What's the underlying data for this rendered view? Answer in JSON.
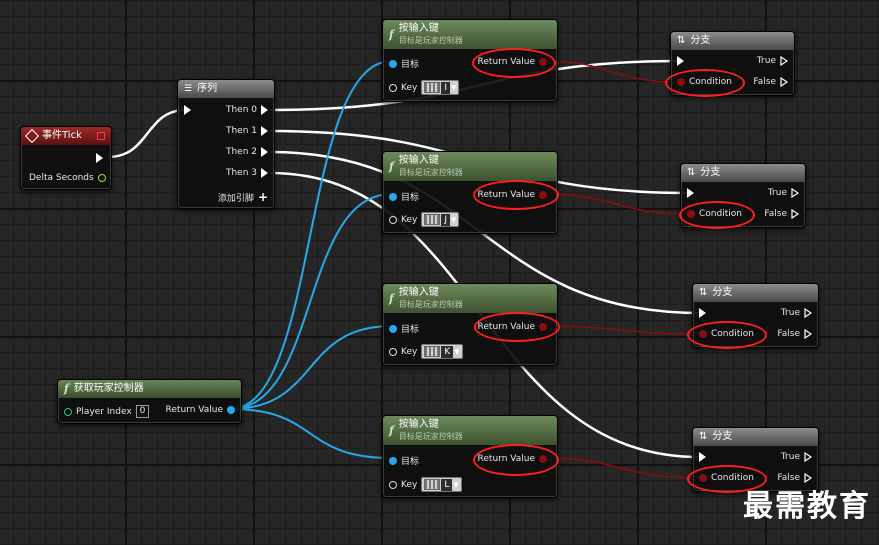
{
  "canvas": {
    "background": "#262626"
  },
  "event_tick": {
    "title": "事件Tick",
    "pin_delta": "Delta Seconds"
  },
  "sequence": {
    "title": "序列",
    "outputs": [
      "Then 0",
      "Then 1",
      "Then 2",
      "Then 3"
    ],
    "add_pin": "添加引脚"
  },
  "get_controller": {
    "title": "获取玩家控制器",
    "player_index_label": "Player Index",
    "player_index_value": "0",
    "return_value": "Return Value"
  },
  "key_nodes": [
    {
      "title": "按输入键",
      "subtitle": "目标是玩家控制器",
      "target": "目标",
      "key_label": "Key",
      "key": "I",
      "return_value": "Return Value"
    },
    {
      "title": "按输入键",
      "subtitle": "目标是玩家控制器",
      "target": "目标",
      "key_label": "Key",
      "key": "J",
      "return_value": "Return Value"
    },
    {
      "title": "按输入键",
      "subtitle": "目标是玩家控制器",
      "target": "目标",
      "key_label": "Key",
      "key": "K",
      "return_value": "Return Value"
    },
    {
      "title": "按输入键",
      "subtitle": "目标是玩家控制器",
      "target": "目标",
      "key_label": "Key",
      "key": "L",
      "return_value": "Return Value"
    }
  ],
  "branch_nodes": [
    {
      "title": "分支",
      "true": "True",
      "false": "False",
      "condition": "Condition"
    },
    {
      "title": "分支",
      "true": "True",
      "false": "False",
      "condition": "Condition"
    },
    {
      "title": "分支",
      "true": "True",
      "false": "False",
      "condition": "Condition"
    },
    {
      "title": "分支",
      "true": "True",
      "false": "False",
      "condition": "Condition"
    }
  ],
  "watermark": "最需教育",
  "colors": {
    "exec_wire": "#ffffff",
    "object_wire": "#2aa7e8",
    "bool_wire": "#8a0d0d",
    "highlight": "#ff1e1e"
  }
}
